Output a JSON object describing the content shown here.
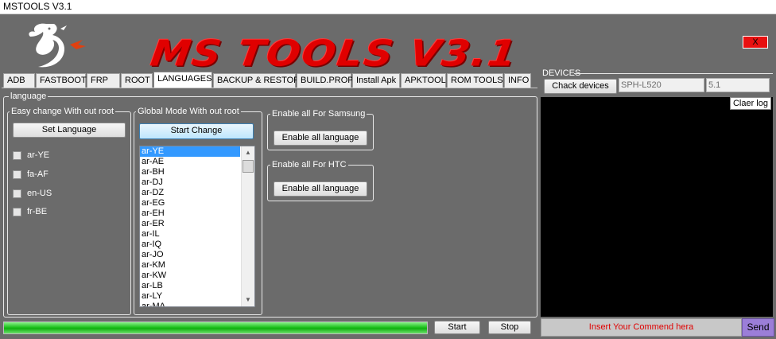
{
  "window": {
    "title": "MSTOOLS V3.1",
    "close_label": "X"
  },
  "banner": {
    "text": "MS TOOLS V3.1"
  },
  "tabs": [
    {
      "label": "ADB"
    },
    {
      "label": "FASTBOOT"
    },
    {
      "label": "FRP"
    },
    {
      "label": "ROOT"
    },
    {
      "label": "LANGUAGES"
    },
    {
      "label": "BACKUP & RESTOR"
    },
    {
      "label": "BUILD.PROP"
    },
    {
      "label": "Install Apk"
    },
    {
      "label": "APKTOOL"
    },
    {
      "label": "ROM TOOLS"
    },
    {
      "label": "INFO"
    }
  ],
  "active_tab": "LANGUAGES",
  "language_panel": {
    "title": "language",
    "easy": {
      "title": "Easy change With out root",
      "set_button": "Set Language",
      "options": [
        "ar-YE",
        "fa-AF",
        "en-US",
        "fr-BE"
      ]
    },
    "global": {
      "title": "Global Mode With out root",
      "start_button": "Start Change",
      "list_items": [
        "ar-YE",
        "ar-AE",
        "ar-BH",
        "ar-DJ",
        "ar-DZ",
        "ar-EG",
        "ar-EH",
        "ar-ER",
        "ar-IL",
        "ar-IQ",
        "ar-JO",
        "ar-KM",
        "ar-KW",
        "ar-LB",
        "ar-LY",
        "ar-MA"
      ],
      "selected": "ar-YE"
    },
    "samsung": {
      "title": "Enable all For Samsung",
      "button": "Enable all language"
    },
    "htc": {
      "title": "Enable all For HTC",
      "button": "Enable all language"
    }
  },
  "bottom": {
    "progress_fraction": 1.0,
    "start_label": "Start",
    "stop_label": "Stop"
  },
  "devices": {
    "title": "DEVICES",
    "check_button": "Chack devices",
    "model": "SPH-L520",
    "version": "5.1",
    "clear_log": "Claer log"
  },
  "command": {
    "placeholder": "Insert Your Commend hera",
    "send_label": "Send"
  },
  "colors": {
    "banner": "#e00000",
    "progress": "#1fc21f",
    "send": "#9b7ed8",
    "log_bg": "#000000"
  }
}
